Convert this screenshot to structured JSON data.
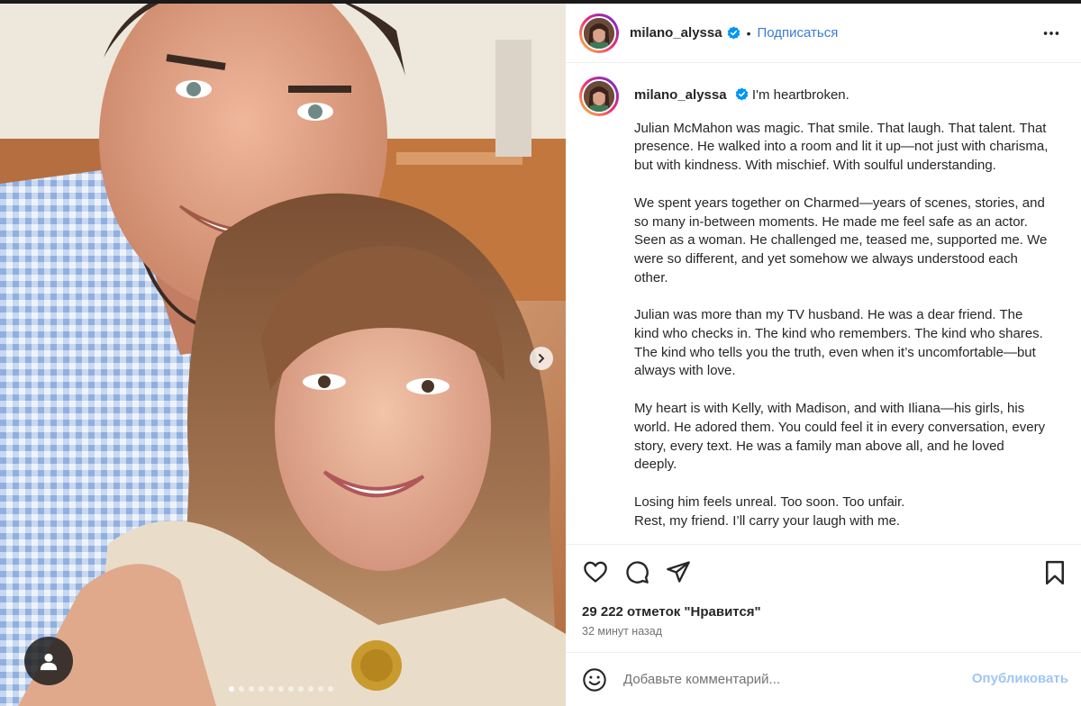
{
  "post": {
    "username": "milano_alyssa",
    "follow_label": "Подписаться",
    "separator": "•",
    "caption_first_line": "I'm heartbroken.",
    "caption_paragraphs": [
      "Julian McMahon was magic. That smile. That laugh. That talent. That presence. He walked into a room and lit it up—not just with charisma, but with kindness. With mischief. With soulful understanding.",
      "We spent years together on Charmed—years of scenes, stories, and so many in-between moments. He made me feel safe as an actor. Seen as a woman. He challenged me, teased me, supported me. We were so different, and yet somehow we always understood each other.",
      "Julian was more than my TV husband. He was a dear friend. The kind who checks in. The kind who remembers. The kind who shares. The kind who tells you the truth, even when it’s uncomfortable—but always with love.",
      "My heart is with Kelly, with Madison, and with Iliana—his girls, his world. He adored them. You could feel it in every conversation, every story, every text. He was a family man above all, and he loved deeply.",
      "Losing him feels unreal. Too soon. Too unfair.\nRest, my friend. I’ll carry your laugh with me."
    ],
    "likes_text": "29 222 отметок \"Нравится\"",
    "time_text": "32 минут назад",
    "comment_placeholder": "Добавьте комментарий...",
    "publish_label": "Опубликовать",
    "carousel": {
      "slide_count": 11,
      "active_index": 0
    }
  },
  "colors": {
    "accent": "#3a7bd5",
    "verified": "#0095f6",
    "publish_disabled": "#9fc6f3",
    "muted": "#737373"
  },
  "icons": [
    "verified-badge-icon",
    "more-options-icon",
    "heart-icon",
    "comment-icon",
    "share-icon",
    "bookmark-icon",
    "emoji-icon",
    "user-tag-icon",
    "chevron-right-icon"
  ]
}
